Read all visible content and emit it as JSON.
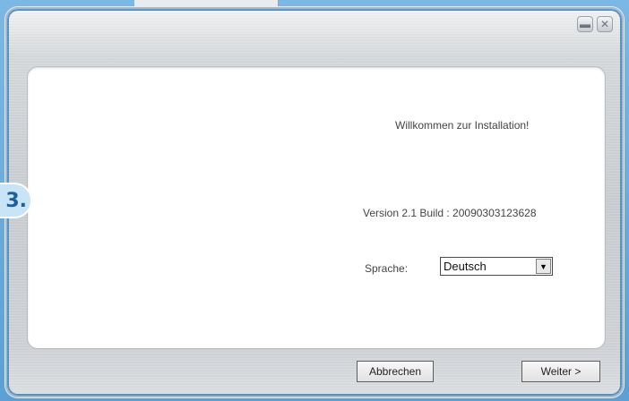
{
  "step_badge": "3.",
  "window": {
    "controls": {
      "minimize_icon": "minimize-icon",
      "close_icon": "close-icon"
    }
  },
  "content": {
    "welcome": "Willkommen zur Installation!",
    "version": "Version 2.1 Build : 20090303123628",
    "language_label": "Sprache:",
    "language_value": "Deutsch"
  },
  "footer": {
    "cancel_label": "Abbrechen",
    "next_label": "Weiter >"
  },
  "colors": {
    "accent": "#1e5f99",
    "badge_bg": "#c8e4f6"
  }
}
